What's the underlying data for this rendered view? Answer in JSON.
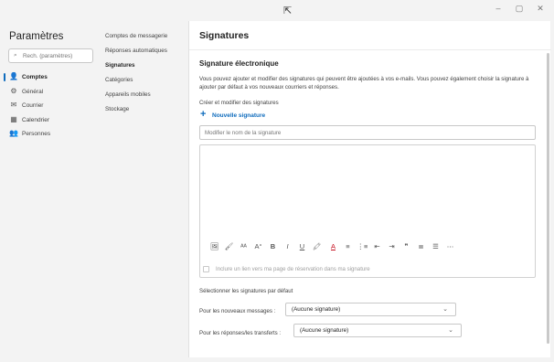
{
  "window": {
    "minimize": "–",
    "maximize": "▢",
    "close": "✕"
  },
  "sidebar": {
    "title": "Paramètres",
    "search_placeholder": "Rech. (paramètres)",
    "items": [
      {
        "label": "Comptes",
        "icon": "person-icon"
      },
      {
        "label": "Général",
        "icon": "gear-icon"
      },
      {
        "label": "Courrier",
        "icon": "mail-icon"
      },
      {
        "label": "Calendrier",
        "icon": "calendar-icon"
      },
      {
        "label": "Personnes",
        "icon": "people-icon"
      }
    ]
  },
  "subnav": {
    "items": [
      {
        "label": "Comptes de messagerie"
      },
      {
        "label": "Réponses automatiques"
      },
      {
        "label": "Signatures"
      },
      {
        "label": "Catégories"
      },
      {
        "label": "Appareils mobiles"
      },
      {
        "label": "Stockage"
      }
    ]
  },
  "content": {
    "title": "Signatures",
    "section_title": "Signature électronique",
    "description": "Vous pouvez ajouter et modifier des signatures qui peuvent être ajoutées à vos e-mails. Vous pouvez également choisir la signature à ajouter par défaut à vos nouveaux courriers et réponses.",
    "create_label": "Créer et modifier des signatures",
    "new_signature": "Nouvelle signature",
    "name_placeholder": "Modifier le nom de la signature",
    "toolbar": {
      "image": "🖼",
      "format_painter": "🖌",
      "font_size": "ᴬᴬ",
      "grow_font": "A°",
      "bold": "B",
      "italic": "I",
      "underline": "U",
      "highlight": "🖍",
      "font_color": "A",
      "bullets": "≡",
      "numbering": "⋮≡",
      "decrease_indent": "⇤",
      "increase_indent": "⇥",
      "quote": "❞",
      "align_left": "≣",
      "align_center": "☰",
      "more": "⋯"
    },
    "booking_checkbox": "Inclure un lien vers ma page de réservation dans ma signature",
    "defaults_title": "Sélectionner les signatures par défaut",
    "new_messages_label": "Pour les nouveaux messages :",
    "new_messages_value": "(Aucune signature)",
    "replies_label": "Pour les réponses/les transferts :",
    "replies_value": "(Aucune signature)"
  },
  "colors": {
    "accent": "#0f6cbd",
    "background": "#f3f3f3",
    "panel": "#ffffff"
  }
}
